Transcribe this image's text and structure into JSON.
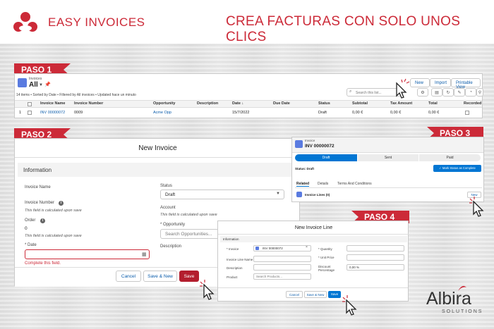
{
  "header": {
    "brand": "EASY INVOICES",
    "tagline": "CREA FACTURAS CON SOLO UNOS CLICS"
  },
  "steps": {
    "paso1": "PASO 1",
    "paso2": "PASO 2",
    "paso3": "PASO 3",
    "paso4": "PASO 4"
  },
  "list_view": {
    "object_label": "Invoices",
    "view_name": "All",
    "buttons": [
      "New",
      "Import",
      "Printable View"
    ],
    "meta": "14 items • Sorted by Date • Filtered by All invoices • Updated hace un minuto",
    "search_placeholder": "Search this list...",
    "columns": [
      "Invoice Name",
      "Invoice Number",
      "Opportunity",
      "Description",
      "Date ↓",
      "Due Date",
      "Status",
      "Subtotal",
      "Tax Amount",
      "Total",
      "Recorded"
    ],
    "row": {
      "index": "1",
      "invoice_name": "INV 00000072",
      "invoice_number": "0009",
      "opportunity": "Acme Opp",
      "description": "",
      "date": "15/7/2022",
      "due_date": "",
      "status": "Draft",
      "subtotal": "0,00 €",
      "tax_amount": "0,00 €",
      "total": "0,00 €"
    }
  },
  "new_invoice": {
    "title": "New Invoice",
    "section": "Information",
    "invoice_name_label": "Invoice Name",
    "invoice_number_label": "Invoice Number",
    "calc_note": "This field is calculated upon save",
    "order_label": "Order",
    "order_value": "0",
    "date_label": "* Date",
    "date_error": "Complete this field.",
    "status_label": "Status",
    "status_value": "Draft",
    "account_label": "Account",
    "opportunity_label": "* Opportunity",
    "opportunity_placeholder": "Search Opportunities...",
    "description_label": "Description",
    "cancel": "Cancel",
    "save_new": "Save & New",
    "save": "Save"
  },
  "invoice_record": {
    "object_label": "Invoice",
    "name": "INV 00000072",
    "path": [
      "Draft",
      "Sent",
      "Paid"
    ],
    "status_text": "Status: Draft",
    "mark_button": "✓ Mark Status as Complete",
    "tabs": [
      "Related",
      "Details",
      "Terms And Conditions"
    ],
    "related_list": "Invoice Lines (0)",
    "new_button": "New"
  },
  "new_line": {
    "title": "New Invoice Line",
    "section": "Information",
    "invoice_label": "* Invoice",
    "invoice_value": "INV 00000072",
    "line_name_label": "Invoice Line Name",
    "description_label": "Description",
    "product_label": "Product",
    "product_placeholder": "Search Products...",
    "quantity_label": "* Quantity",
    "unit_price_label": "* Unit Price",
    "discount_label": "Discount Percentage",
    "discount_value": "0,00 %",
    "cancel": "Cancel",
    "save_new": "Save & New",
    "save": "Save"
  },
  "albira": {
    "name": "Albira",
    "sub": "SOLUTIONS"
  },
  "colors": {
    "brand_red": "#cc2a38",
    "salesforce_blue": "#0176d3"
  }
}
